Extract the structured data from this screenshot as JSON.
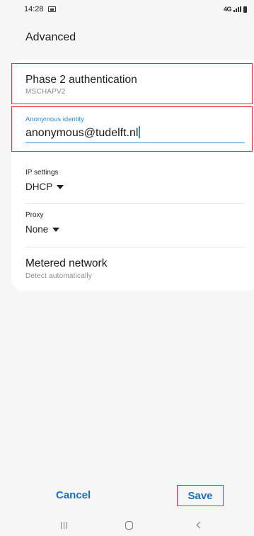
{
  "status_bar": {
    "time": "14:28",
    "network_label": "4G"
  },
  "page": {
    "title": "Advanced"
  },
  "phase2": {
    "title": "Phase 2 authentication",
    "value": "MSCHAPV2"
  },
  "anonymous_identity": {
    "label": "Anonymous identity",
    "value": "anonymous@tudelft.nl"
  },
  "ip_settings": {
    "label": "IP settings",
    "value": "DHCP"
  },
  "proxy": {
    "label": "Proxy",
    "value": "None"
  },
  "metered": {
    "title": "Metered network",
    "value": "Detect automatically"
  },
  "actions": {
    "cancel_label": "Cancel",
    "save_label": "Save"
  },
  "nav": {
    "recent_icon": "recent-apps-icon",
    "home_icon": "home-icon",
    "back_icon": "back-icon"
  },
  "colors": {
    "accent": "#2f89d8",
    "button_text": "#1f6fb4",
    "highlight_border": "#e0323c"
  }
}
